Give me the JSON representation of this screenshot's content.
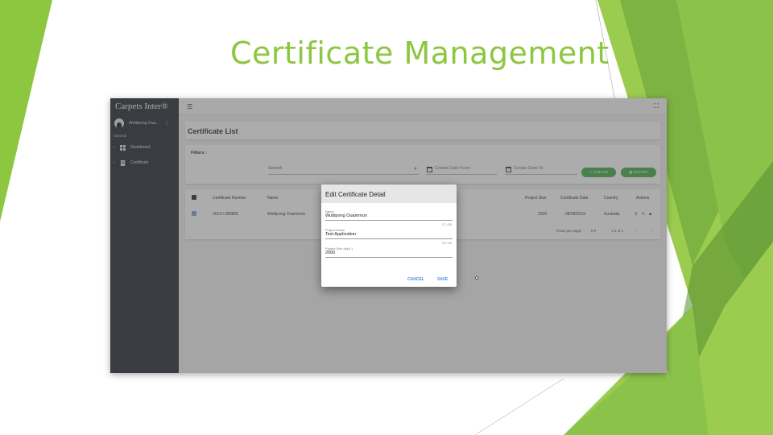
{
  "slide": {
    "title": "Certificate Management",
    "accent_color": "#8dc63f"
  },
  "app": {
    "brand": "Carpets Inter®",
    "user": {
      "name": "Wuttipong Oua...",
      "menu_icon": "kebab-icon"
    },
    "sidebar": {
      "section": "General",
      "items": [
        {
          "label": "Dashboard",
          "icon": "dashboard-icon"
        },
        {
          "label": "Certificate",
          "icon": "document-icon"
        }
      ]
    },
    "topbar": {
      "menu_icon": "hamburger-icon",
      "fullscreen_icon": "fullscreen-icon"
    },
    "list": {
      "title": "Certificate List",
      "filters_label": "Filters :",
      "search_placeholder": "Search",
      "date_from_placeholder": "Create Date From",
      "date_to_placeholder": "Create Date To",
      "create_label": "CREATE",
      "export_label": "EXPORT",
      "button_color": "#4caf50",
      "columns": [
        "Certificate Number",
        "Name",
        "Project Size",
        "Certificate Date",
        "Country",
        "Actions"
      ],
      "rows": [
        {
          "certificate_number": "2019 / 080805",
          "name": "Wuttipong Ouammun",
          "project_size": "2500",
          "certificate_date": "08/08/2019",
          "country": "Australia"
        }
      ],
      "rows_per_page_label": "Rows per page:",
      "rows_per_page_value": "5",
      "range_label": "1-1 of 1"
    },
    "dialog": {
      "title": "Edit Certificate Detail",
      "fields": [
        {
          "label": "Name",
          "value": "Wuttipong Ouammun",
          "counter": "17 / 50"
        },
        {
          "label": "Project Name",
          "value": "Test Application",
          "counter": "16 / 50"
        },
        {
          "label": "Project Size (sq.ft.)",
          "value": "2500"
        }
      ],
      "cancel_label": "CANCEL",
      "save_label": "SAVE",
      "action_color": "#4a90e2"
    }
  }
}
